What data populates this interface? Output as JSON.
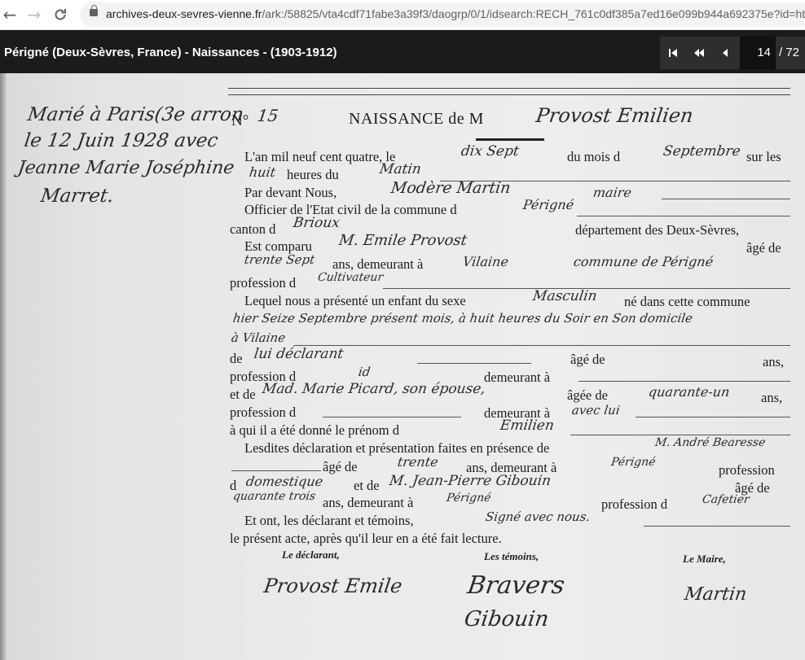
{
  "browser": {
    "url_domain": "archives-deux-sevres-vienne.fr",
    "url_path": "/ark:/58825/vta4cdf71fabe3a39f3/daogrp/0/1/idsearch:RECH_761c0df385a7ed16e099b944a692375e?id=htt..."
  },
  "viewer": {
    "title": "Périgné (Deux-Sèvres, France) - Naissances - (1903-1912)",
    "current_page": "14",
    "total_pages": "/ 72"
  },
  "document": {
    "number_label": "N°",
    "number_value": "15",
    "heading": "NAISSANCE de M",
    "name": "Provost Emilien",
    "margin_note": [
      "Marié à Paris(3e arron",
      "le 12 Juin 1928 avec",
      "Jeanne Marie Joséphine",
      "Marret."
    ],
    "l1a": "L'an mil neuf cent quatre, le",
    "l1_day": "dix Sept",
    "l1b": "du mois d",
    "l1_month": "Septembre",
    "l1c": "sur les",
    "l2_hour": "huit",
    "l2a": "heures du",
    "l2_time": "Matin",
    "l3a": "Par devant Nous,",
    "l3_name": "Modère Martin",
    "l3_title": "maire",
    "l4a": "Officier de l'Etat civil de la commune d",
    "l4_commune": "Périgné",
    "l5a": "canton d",
    "l5_canton": "Brioux",
    "l5b": "département des Deux-Sèvres,",
    "l6a": "Est comparu",
    "l6_name": "M. Emile Provost",
    "l6b": "âgé de",
    "l7_age": "trente Sept",
    "l7a": "ans, demeurant à",
    "l7_place": "Vilaine",
    "l7_commune": "commune de Périgné",
    "l8a": "profession d",
    "l8_prof": "Cultivateur",
    "l9a": "Lequel nous a présenté un enfant du sexe",
    "l9_sex": "Masculin",
    "l9b": "né dans cette commune",
    "l10_hw": "hier Seize Septembre présent mois, à huit heures du Soir en Son domicile",
    "l11_hw": "à Vilaine",
    "l12a": "de",
    "l12_hw": "lui déclarant",
    "l12b": "âgé de",
    "l12c": "ans,",
    "l13a": "profession d",
    "l13_hw": "id",
    "l13b": "demeurant à",
    "l14a": "et de",
    "l14_hw": "Mad. Marie Picard, son épouse,",
    "l14b": "âgée de",
    "l14_age": "quarante-un",
    "l14c": "ans,",
    "l15a": "profession d",
    "l15b": "demeurant à",
    "l15_hw": "avec lui",
    "l16a": "à qui il a été donné le  prénom  d",
    "l16_hw": "Emilien",
    "l17a": "Lesdites déclaration et présentation faites en présence de",
    "l17_hw": "M. André Bearesse",
    "l18a": "âgé de",
    "l18_age": "trente",
    "l18b": "ans, demeurant à",
    "l18_place": "Périgné",
    "l18c": "profession",
    "l19a": "d",
    "l19_prof": "domestique",
    "l19b": "et de",
    "l19_name": "M. Jean-Pierre Gibouin",
    "l19c": "âgé de",
    "l20_age": "quarante trois",
    "l20a": "ans, demeurant à",
    "l20_place": "Périgné",
    "l20b": "profession d",
    "l20_prof": "Cafetier",
    "l21a": "Et ont, les déclarant et témoins,",
    "l21_hw": "Signé avec nous.",
    "l22a": "le présent acte, après qu'il leur en a été fait lecture.",
    "sig_declarant_label": "Le déclarant,",
    "sig_witnesses_label": "Les témoins,",
    "sig_mayor_label": "Le Maire,",
    "sig_declarant": "Provost Emile",
    "sig_witness1": "Bravers",
    "sig_witness2": "Gibouin",
    "sig_mayor": "Martin"
  }
}
